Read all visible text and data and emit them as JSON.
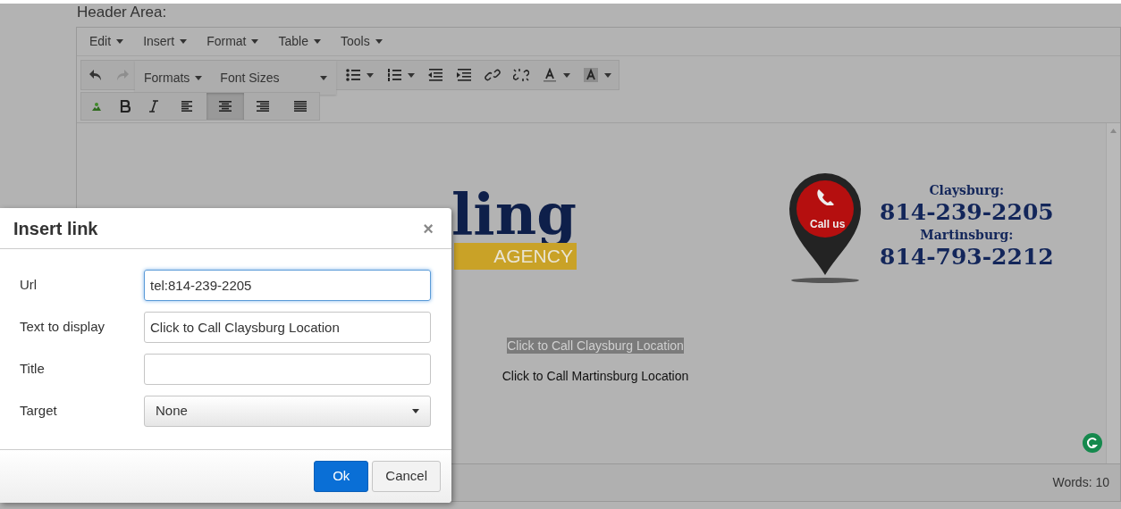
{
  "page_heading": "Header Area:",
  "menubar": [
    {
      "label": "Edit"
    },
    {
      "label": "Insert"
    },
    {
      "label": "Format"
    },
    {
      "label": "Table"
    },
    {
      "label": "Tools"
    }
  ],
  "toolbar": {
    "redo_disabled": true,
    "dropdowns": [
      "Formats",
      "Font Sizes"
    ],
    "alignment": [
      {
        "kind": "left",
        "selected": false
      },
      {
        "kind": "center",
        "selected": true
      },
      {
        "kind": "right",
        "selected": false
      },
      {
        "kind": "justify",
        "selected": false
      }
    ]
  },
  "document": {
    "logo": {
      "word": "ling",
      "tagline": "AGENCY"
    },
    "call_us": {
      "badge": "Call us",
      "locations": [
        {
          "name": "Claysburg:",
          "phone": "814-239-2205"
        },
        {
          "name": "Martinsburg:",
          "phone": "814-793-2212"
        }
      ]
    },
    "links": [
      {
        "text": "Click to Call Claysburg Location",
        "selected": true
      },
      {
        "text": "Click to Call Martinsburg Location",
        "selected": false
      }
    ]
  },
  "status_bar": {
    "words": "Words: 10"
  },
  "dialog": {
    "title": "Insert link",
    "close": "×",
    "fields": [
      {
        "kind": "text",
        "label": "Url",
        "value": "tel:814-239-2205",
        "focused": true
      },
      {
        "kind": "text",
        "label": "Text to display",
        "value": "Click to Call Claysburg Location",
        "focused": false
      },
      {
        "kind": "text",
        "label": "Title",
        "focused": false
      },
      {
        "kind": "select",
        "label": "Target",
        "value": "None"
      }
    ],
    "buttons": [
      {
        "label": "Ok",
        "primary": true
      },
      {
        "label": "Cancel",
        "primary": false
      }
    ]
  }
}
